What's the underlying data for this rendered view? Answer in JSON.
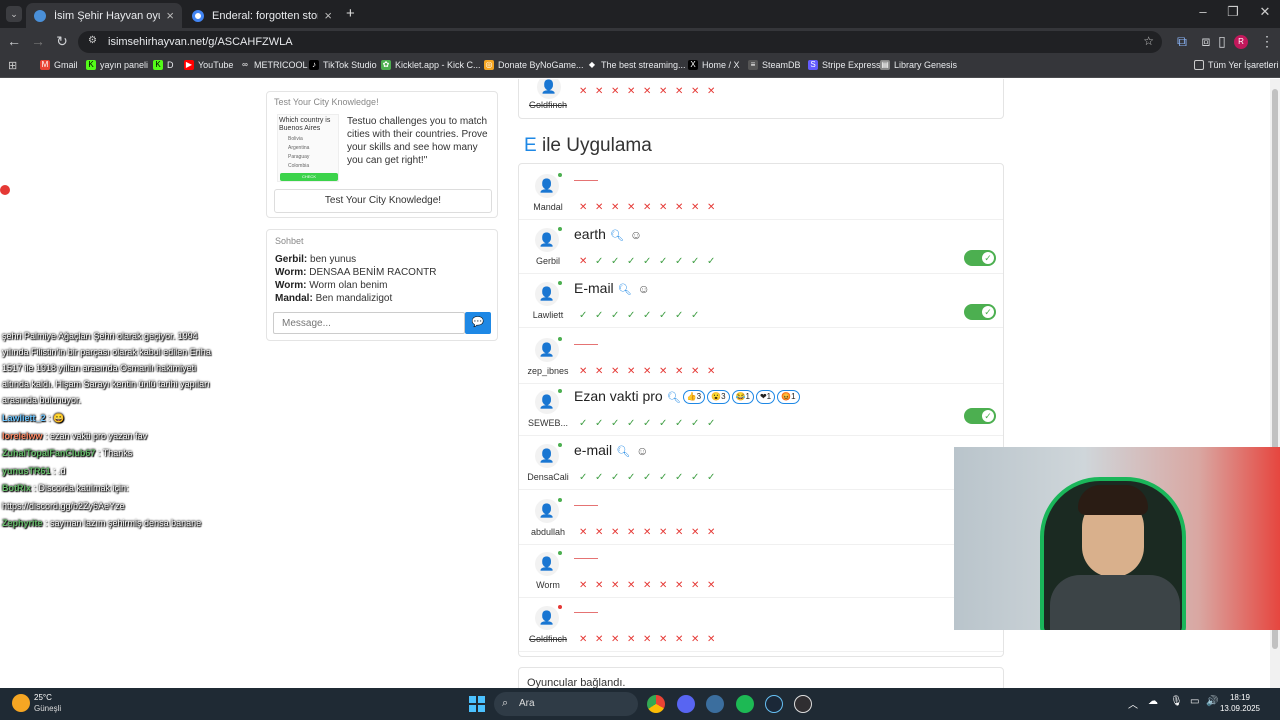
{
  "browser": {
    "tabs": [
      {
        "title": "İsim Şehir Hayvan oyununa katıl",
        "active": true
      },
      {
        "title": "Enderal: forgotten stories - Goo",
        "active": false
      }
    ],
    "new_tab": "+",
    "url": "isimsehirhayvan.net/g/ASCAHFZWLA",
    "bookmarks": [
      "Gmail",
      "yayın paneli",
      "D",
      "YouTube",
      "METRICOOL",
      "TikTok Studio",
      "Kicklet.app - Kick C...",
      "Donate ByNoGame...",
      "The best streaming...",
      "Home / X",
      "SteamDB",
      "Stripe Express",
      "Library Genesis"
    ],
    "all_bookmarks": "Tüm Yer İşaretleri",
    "profile": "R"
  },
  "ad": {
    "title": "Test Your City Knowledge!",
    "question": "Which country is Buenos Aires",
    "options": [
      "Bolivia",
      "Argentina",
      "Paraguay",
      "Colombia"
    ],
    "cta_small": "CHECK",
    "description": "Testuo challenges you to match cities with their countries. Prove your skills and see how many you can get right!\"",
    "button": "Test Your City Knowledge!"
  },
  "chat": {
    "title": "Sohbet",
    "messages": [
      {
        "user": "Gerbil:",
        "text": "ben yunus"
      },
      {
        "user": "Worm:",
        "text": "DENSAA BENİM RACONTR"
      },
      {
        "user": "Worm:",
        "text": "Worm olan benim"
      },
      {
        "user": "Mandal:",
        "text": "Ben mandalizigot"
      }
    ],
    "placeholder": "Message..."
  },
  "category": {
    "letter": "E",
    "title": "ile Uygulama",
    "top_player": "Goldfinch",
    "rows": [
      {
        "name": "Mandal",
        "answer": "",
        "marks": "xxxxxxxxx"
      },
      {
        "name": "Gerbil",
        "answer": "earth",
        "marks": "xcccccccc",
        "toggle": true
      },
      {
        "name": "Lawliett",
        "answer": "E-mail",
        "marks": "cccccccc",
        "toggle": true
      },
      {
        "name": "zep_ibnes",
        "answer": "",
        "marks": "xxxxxxxxx"
      },
      {
        "name": "SEWEB...",
        "answer": "Ezan vakti pro",
        "marks": "ccccccccc",
        "toggle": true,
        "reactions": [
          "👍3",
          "😮3",
          "😂1",
          "❤1",
          "😡1"
        ]
      },
      {
        "name": "DensaCali",
        "answer": "e-mail",
        "marks": "ccccccccc"
      },
      {
        "name": "abdullah",
        "answer": "",
        "marks": "xxxxxxxxx"
      },
      {
        "name": "Worm",
        "answer": "",
        "marks": "xxxxxxxxx"
      },
      {
        "name": "Goldfinch",
        "answer": "",
        "marks": "xxxxxxxxx",
        "offline": true
      }
    ],
    "footer": "Oyuncular bağlandı."
  },
  "overlay": {
    "lines": [
      "şehri Palmiye Ağaçları Şehri olarak geçiyor. 1994",
      "yılında Filistin'in bir parçası olarak kabul edilen Eriha",
      "1517 ile 1918 yılları arasında Osmanlı hakimiyeti",
      "altında kaldı. Hişam Sarayı kentin ünlü tarihi yapıları",
      "arasında bulunuyor."
    ],
    "chat": [
      {
        "user": "Lawliett_2",
        "text": ": 😀"
      },
      {
        "user": "lorelelww",
        "text": ": ezan vakti pro yazan fav"
      },
      {
        "user": "ZuhalTopalFanClub67",
        "text": ": Thanks"
      },
      {
        "user": "yunusTR61",
        "text": ": .d"
      },
      {
        "user": "BotRix",
        "text": ": Discorda katılmak için:"
      },
      {
        "user": "",
        "text": "https://discord.gg/b2Zy6AeYze"
      },
      {
        "user": "Zephyrite",
        "text": ": sayman lazım şehirmiş densa banane"
      }
    ]
  },
  "taskbar": {
    "weather_temp": "25°C",
    "weather_desc": "Güneşli",
    "search": "Ara",
    "time": "18:19",
    "date": "13.09.2025"
  }
}
